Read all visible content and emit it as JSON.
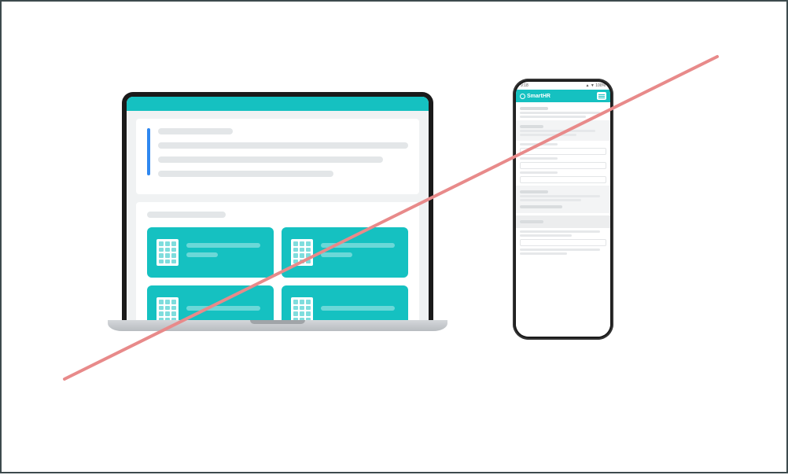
{
  "colors": {
    "teal": "#15c1c1",
    "teal_light": "#6bd8d8",
    "strike": "#e88a8a",
    "accent_blue": "#2f88f0"
  },
  "phone": {
    "status_time": "9:18",
    "brand_label": "SmartHR",
    "status_icons": "▲ ▼ 100%"
  },
  "laptop": {
    "cards_count": 4
  }
}
